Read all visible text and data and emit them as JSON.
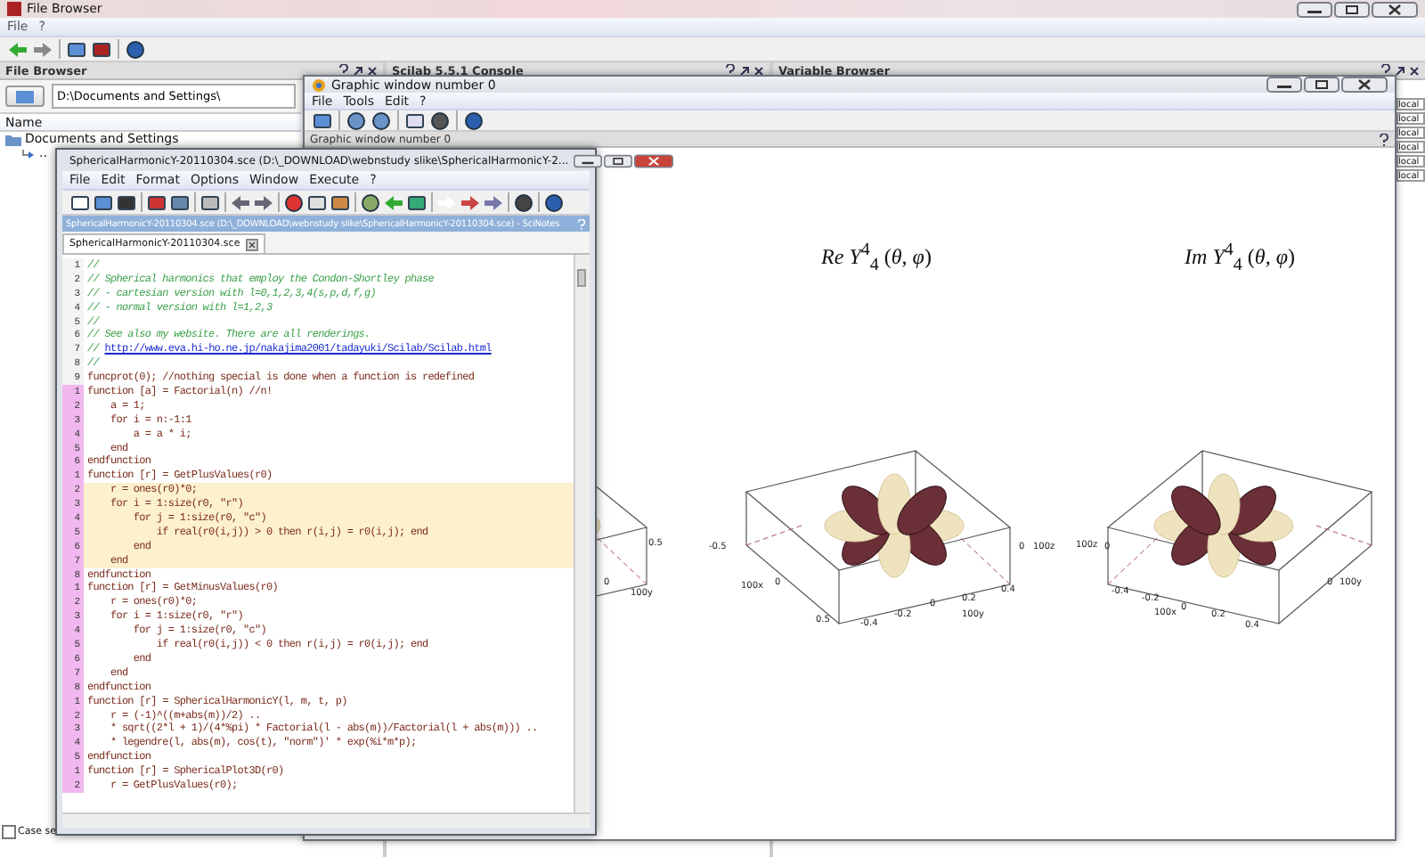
{
  "main_window": {
    "title": "File Browser",
    "menu": [
      "File",
      "?"
    ]
  },
  "file_browser": {
    "header": "File Browser",
    "path": "D:\\Documents and Settings\\",
    "column": "Name",
    "tree": [
      {
        "label": "Documents and Settings",
        "children": [
          {
            "label": ".."
          }
        ]
      }
    ],
    "case_option": {
      "label": "Case se",
      "checked": false
    }
  },
  "console": {
    "header": "Scilab 5.5.1 Console"
  },
  "variable_browser": {
    "header": "Variable Browser",
    "visibility_cells": [
      "local",
      "local",
      "local",
      "local",
      "local",
      "local"
    ]
  },
  "graphic_window": {
    "title": "Graphic window number 0",
    "menu": [
      "File",
      "Tools",
      "Edit",
      "?"
    ],
    "panel_title": "Graphic window number 0",
    "plots": [
      {
        "tick_labels": [
          "0.5",
          "0",
          "100y"
        ]
      },
      {
        "title": "*Re* *Y*$^{4}$$_{4}$ (*θ*, *φ*)",
        "tick_labels": [
          "-0.5",
          "100x",
          "0",
          "0.5",
          "-0.4",
          "-0.2",
          "0",
          "0.2",
          "100y",
          "0.4",
          "0",
          "100z"
        ]
      },
      {
        "title": "*Im* *Y*$^{4}$$_{4}$ (*θ*, *φ*)",
        "tick_labels": [
          "100z",
          "0",
          "-0.4",
          "-0.2",
          "0",
          "100x",
          "0.2",
          "0.4",
          "0",
          "100y"
        ]
      }
    ]
  },
  "editor": {
    "title": "SphericalHarmonicY-20110304.sce (D:\\_DOWNLOAD\\webnstudy slike\\SphericalHarmonicY-2...",
    "menu": [
      "File",
      "Edit",
      "Format",
      "Options",
      "Window",
      "Execute",
      "?"
    ],
    "doc_bar": "SphericalHarmonicY-20110304.sce (D:\\_DOWNLOAD\\webnstudy slike\\SphericalHarmonicY-20110304.sce) - SciNotes",
    "tabs": [
      {
        "label": "SphericalHarmonicY-20110304.sce",
        "selected": true
      }
    ],
    "blocks": [
      {
        "kind": "script",
        "lines": [
          {
            "n": "1",
            "kind": "comment",
            "text": "//",
            "highlighted": false
          },
          {
            "n": "2",
            "kind": "comment",
            "text": "// Spherical harmonics that employ the Condon-Shortley phase",
            "highlighted": false
          },
          {
            "n": "3",
            "kind": "comment",
            "text": "// - cartesian version with l=0,1,2,3,4(s,p,d,f,g)",
            "highlighted": false
          },
          {
            "n": "4",
            "kind": "comment",
            "text": "// - normal version with l=1,2,3",
            "highlighted": false
          },
          {
            "n": "5",
            "kind": "comment",
            "text": "//",
            "highlighted": false
          },
          {
            "n": "6",
            "kind": "comment",
            "text": "// See also my website. There are all renderings.",
            "highlighted": false
          },
          {
            "n": "7",
            "kind": "link",
            "text": "// ",
            "link": "http://www.eva.hi-ho.ne.jp/nakajima2001/tadayuki/Scilab/Scilab.html",
            "highlighted": false
          },
          {
            "n": "8",
            "kind": "comment",
            "text": "//",
            "highlighted": false
          },
          {
            "n": "9",
            "kind": "code",
            "text": "funcprot(0); //nothing special is done when a function is redefined",
            "highlighted": false
          }
        ]
      },
      {
        "kind": "function",
        "lines": [
          {
            "n": "1",
            "kind": "code",
            "text": "function [a] = Factorial(n) //n!",
            "highlighted": false
          },
          {
            "n": "2",
            "kind": "code",
            "text": "    a = 1;",
            "highlighted": false
          },
          {
            "n": "3",
            "kind": "code",
            "text": "    for i = n:-1:1",
            "highlighted": false
          },
          {
            "n": "4",
            "kind": "code",
            "text": "        a = a * i;",
            "highlighted": false
          },
          {
            "n": "5",
            "kind": "code",
            "text": "    end",
            "highlighted": false
          },
          {
            "n": "6",
            "kind": "code",
            "text": "endfunction",
            "highlighted": false
          }
        ]
      },
      {
        "kind": "function",
        "lines": [
          {
            "n": "1",
            "kind": "code",
            "text": "function [r] = GetPlusValues(r0)",
            "highlighted": false
          },
          {
            "n": "2",
            "kind": "code",
            "text": "    r = ones(r0)*0;",
            "highlighted": true
          },
          {
            "n": "3",
            "kind": "code",
            "text": "    for i = 1:size(r0, \"r\")",
            "highlighted": true
          },
          {
            "n": "4",
            "kind": "code",
            "text": "        for j = 1:size(r0, \"c\")",
            "highlighted": true
          },
          {
            "n": "5",
            "kind": "code",
            "text": "            if real(r0(i,j)) > 0 then r(i,j) = r0(i,j); end",
            "highlighted": true
          },
          {
            "n": "6",
            "kind": "code",
            "text": "        end",
            "highlighted": true
          },
          {
            "n": "7",
            "kind": "code",
            "text": "    end",
            "highlighted": true
          },
          {
            "n": "8",
            "kind": "code",
            "text": "endfunction",
            "highlighted": false
          }
        ]
      },
      {
        "kind": "function",
        "lines": [
          {
            "n": "1",
            "kind": "code",
            "text": "function [r] = GetMinusValues(r0)",
            "highlighted": false
          },
          {
            "n": "2",
            "kind": "code",
            "text": "    r = ones(r0)*0;",
            "highlighted": false
          },
          {
            "n": "3",
            "kind": "code",
            "text": "    for i = 1:size(r0, \"r\")",
            "highlighted": false
          },
          {
            "n": "4",
            "kind": "code",
            "text": "        for j = 1:size(r0, \"c\")",
            "highlighted": false
          },
          {
            "n": "5",
            "kind": "code",
            "text": "            if real(r0(i,j)) < 0 then r(i,j) = r0(i,j); end",
            "highlighted": false
          },
          {
            "n": "6",
            "kind": "code",
            "text": "        end",
            "highlighted": false
          },
          {
            "n": "7",
            "kind": "code",
            "text": "    end",
            "highlighted": false
          },
          {
            "n": "8",
            "kind": "code",
            "text": "endfunction",
            "highlighted": false
          }
        ]
      },
      {
        "kind": "function",
        "lines": [
          {
            "n": "1",
            "kind": "code",
            "text": "function [r] = SphericalHarmonicY(l, m, t, p)",
            "highlighted": false
          },
          {
            "n": "2",
            "kind": "code",
            "text": "    r = (-1)^((m+abs(m))/2) ..",
            "highlighted": false
          },
          {
            "n": "3",
            "kind": "code",
            "text": "    * sqrt((2*l + 1)/(4*%pi) * Factorial(l - abs(m))/Factorial(l + abs(m))) ..",
            "highlighted": false
          },
          {
            "n": "4",
            "kind": "code",
            "text": "    * legendre(l, abs(m), cos(t), \"norm\")' * exp(%i*m*p);",
            "highlighted": false
          },
          {
            "n": "5",
            "kind": "code",
            "text": "endfunction",
            "highlighted": false
          }
        ]
      },
      {
        "kind": "function",
        "lines": [
          {
            "n": "1",
            "kind": "code",
            "text": "function [r] = SphericalPlot3D(r0)",
            "highlighted": false
          },
          {
            "n": "2",
            "kind": "code",
            "text": "    r = GetPlusValues(r0);",
            "highlighted": false
          }
        ]
      }
    ]
  }
}
